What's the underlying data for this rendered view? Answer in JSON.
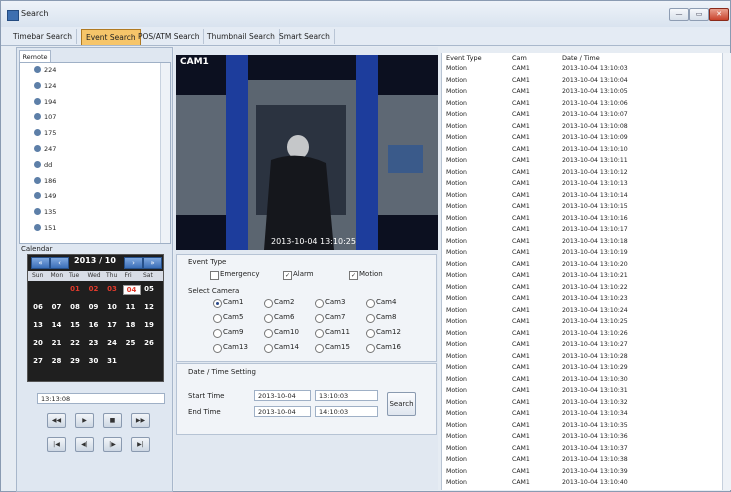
{
  "window": {
    "title": "Search",
    "buttons": [
      "—",
      "▭",
      "✕"
    ]
  },
  "tabs": [
    {
      "label": "Timebar Search",
      "active": false
    },
    {
      "label": "Event Search",
      "active": true
    },
    {
      "label": "POS/ATM Search",
      "active": false
    },
    {
      "label": "Thumbnail Search",
      "active": false
    },
    {
      "label": "Smart Search",
      "active": false
    }
  ],
  "remote": {
    "tab_label": "Remote",
    "tree_items": [
      "224",
      "124",
      "194",
      "107",
      "175",
      "247",
      "dd",
      "186",
      "149",
      "135",
      "151"
    ]
  },
  "calendar": {
    "label": "Calendar",
    "month_label": "2013 / 10",
    "weekdays": [
      "Sun",
      "Mon",
      "Tue",
      "Wed",
      "Thu",
      "Fri",
      "Sat"
    ],
    "week1": [
      {
        "d": "01",
        "red": true
      },
      {
        "d": "02",
        "red": true
      },
      {
        "d": "03",
        "red": true
      },
      {
        "d": "04",
        "sel": true
      },
      {
        "d": "05"
      }
    ],
    "weeks": [
      [
        "06",
        "07",
        "08",
        "09",
        "10",
        "11",
        "12"
      ],
      [
        "13",
        "14",
        "15",
        "16",
        "17",
        "18",
        "19"
      ],
      [
        "20",
        "21",
        "22",
        "23",
        "24",
        "25",
        "26"
      ],
      [
        "27",
        "28",
        "29",
        "30",
        "31"
      ]
    ]
  },
  "player": {
    "time_value": "13:13:08",
    "row1": [
      "◀◀",
      "▶",
      "■",
      "▶▶"
    ],
    "row2": [
      "|◀",
      "◀|",
      "|▶",
      "▶|"
    ]
  },
  "video": {
    "camera": "CAM1",
    "timestamp": "2013-10-04 13:10:25"
  },
  "event_type": {
    "label": "Event Type",
    "options": [
      {
        "label": "Emergency",
        "checked": false
      },
      {
        "label": "Alarm",
        "checked": true
      },
      {
        "label": "Motion",
        "checked": true
      }
    ]
  },
  "select_camera": {
    "label": "Select Camera",
    "cams": [
      "Cam1",
      "Cam2",
      "Cam3",
      "Cam4",
      "Cam5",
      "Cam6",
      "Cam7",
      "Cam8",
      "Cam9",
      "Cam10",
      "Cam11",
      "Cam12",
      "Cam13",
      "Cam14",
      "Cam15",
      "Cam16"
    ],
    "selected": "Cam1"
  },
  "datetime": {
    "label": "Date / Time Setting",
    "start_label": "Start Time",
    "end_label": "End Time",
    "start_date": "2013-10-04",
    "start_time": "13:10:03",
    "end_date": "2013-10-04",
    "end_time": "14:10:03",
    "search_label": "Search"
  },
  "results": {
    "headers": [
      "Event Type",
      "Cam",
      "Date / Time"
    ],
    "rows": [
      [
        "Motion",
        "CAM1",
        "2013-10-04 13:10:03"
      ],
      [
        "Motion",
        "CAM1",
        "2013-10-04 13:10:04"
      ],
      [
        "Motion",
        "CAM1",
        "2013-10-04 13:10:05"
      ],
      [
        "Motion",
        "CAM1",
        "2013-10-04 13:10:06"
      ],
      [
        "Motion",
        "CAM1",
        "2013-10-04 13:10:07"
      ],
      [
        "Motion",
        "CAM1",
        "2013-10-04 13:10:08"
      ],
      [
        "Motion",
        "CAM1",
        "2013-10-04 13:10:09"
      ],
      [
        "Motion",
        "CAM1",
        "2013-10-04 13:10:10"
      ],
      [
        "Motion",
        "CAM1",
        "2013-10-04 13:10:11"
      ],
      [
        "Motion",
        "CAM1",
        "2013-10-04 13:10:12"
      ],
      [
        "Motion",
        "CAM1",
        "2013-10-04 13:10:13"
      ],
      [
        "Motion",
        "CAM1",
        "2013-10-04 13:10:14"
      ],
      [
        "Motion",
        "CAM1",
        "2013-10-04 13:10:15"
      ],
      [
        "Motion",
        "CAM1",
        "2013-10-04 13:10:16"
      ],
      [
        "Motion",
        "CAM1",
        "2013-10-04 13:10:17"
      ],
      [
        "Motion",
        "CAM1",
        "2013-10-04 13:10:18"
      ],
      [
        "Motion",
        "CAM1",
        "2013-10-04 13:10:19"
      ],
      [
        "Motion",
        "CAM1",
        "2013-10-04 13:10:20"
      ],
      [
        "Motion",
        "CAM1",
        "2013-10-04 13:10:21"
      ],
      [
        "Motion",
        "CAM1",
        "2013-10-04 13:10:22"
      ],
      [
        "Motion",
        "CAM1",
        "2013-10-04 13:10:23"
      ],
      [
        "Motion",
        "CAM1",
        "2013-10-04 13:10:24"
      ],
      [
        "Motion",
        "CAM1",
        "2013-10-04 13:10:25"
      ],
      [
        "Motion",
        "CAM1",
        "2013-10-04 13:10:26"
      ],
      [
        "Motion",
        "CAM1",
        "2013-10-04 13:10:27"
      ],
      [
        "Motion",
        "CAM1",
        "2013-10-04 13:10:28"
      ],
      [
        "Motion",
        "CAM1",
        "2013-10-04 13:10:29"
      ],
      [
        "Motion",
        "CAM1",
        "2013-10-04 13:10:30"
      ],
      [
        "Motion",
        "CAM1",
        "2013-10-04 13:10:31"
      ],
      [
        "Motion",
        "CAM1",
        "2013-10-04 13:10:32"
      ],
      [
        "Motion",
        "CAM1",
        "2013-10-04 13:10:34"
      ],
      [
        "Motion",
        "CAM1",
        "2013-10-04 13:10:35"
      ],
      [
        "Motion",
        "CAM1",
        "2013-10-04 13:10:36"
      ],
      [
        "Motion",
        "CAM1",
        "2013-10-04 13:10:37"
      ],
      [
        "Motion",
        "CAM1",
        "2013-10-04 13:10:38"
      ],
      [
        "Motion",
        "CAM1",
        "2013-10-04 13:10:39"
      ],
      [
        "Motion",
        "CAM1",
        "2013-10-04 13:10:40"
      ]
    ]
  }
}
